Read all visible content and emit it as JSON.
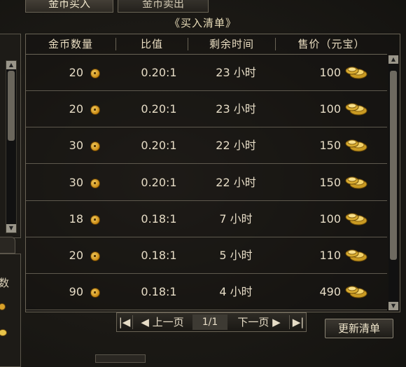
{
  "tabs": [
    "金币买入",
    "金币卖出"
  ],
  "title": "《买入清单》",
  "columns": [
    "金币数量",
    "比值",
    "剩余时间",
    "售价（元宝）"
  ],
  "rows": [
    {
      "amount": "20",
      "ratio": "0.20:1",
      "time": "23 小时",
      "price": "100"
    },
    {
      "amount": "20",
      "ratio": "0.20:1",
      "time": "23 小时",
      "price": "100"
    },
    {
      "amount": "30",
      "ratio": "0.20:1",
      "time": "22 小时",
      "price": "150"
    },
    {
      "amount": "30",
      "ratio": "0.20:1",
      "time": "22 小时",
      "price": "150"
    },
    {
      "amount": "18",
      "ratio": "0.18:1",
      "time": "7 小时",
      "price": "100"
    },
    {
      "amount": "20",
      "ratio": "0.18:1",
      "time": "5 小时",
      "price": "110"
    },
    {
      "amount": "90",
      "ratio": "0.18:1",
      "time": "4 小时",
      "price": "490"
    }
  ],
  "pager": {
    "first_icon": "first-page-icon",
    "prev_label": "◀ 上一页",
    "page_indicator": "1/1",
    "next_label": "下一页 ▶",
    "last_icon": "last-page-icon"
  },
  "refresh_label": "更新清单",
  "left_panel_char": "数",
  "colors": {
    "coin": "#d9a22a",
    "ingot": "#e8c44a",
    "border": "#6a6456"
  }
}
